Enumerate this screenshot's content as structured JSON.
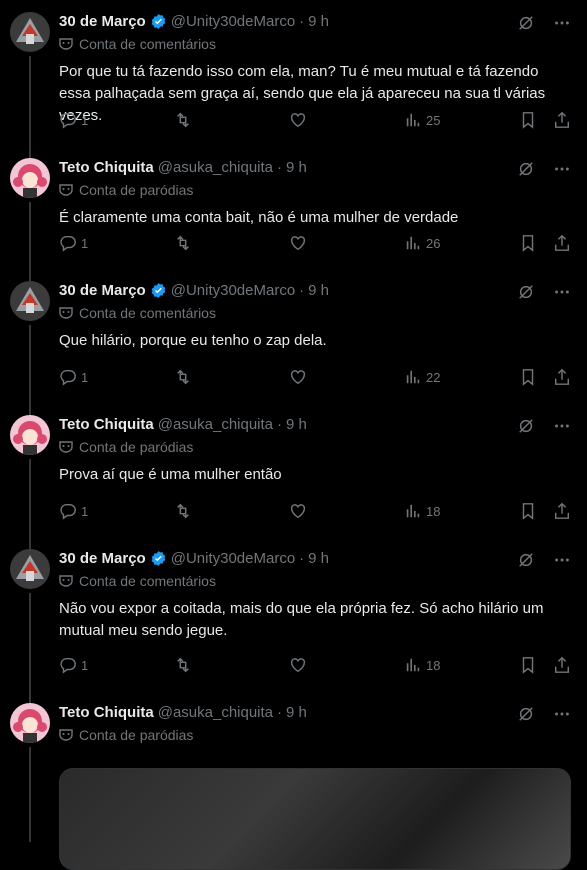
{
  "tweets": [
    {
      "author": "30 de Março",
      "handle": "@Unity30deMarco",
      "time": "9 h",
      "verified": true,
      "label": "Conta de comentários",
      "text": "Por que tu tá fazendo isso com ela, man? Tu é meu mutual e tá fazendo essa palhaçada sem graça aí, sendo que ela já apareceu na sua tl várias vezes.",
      "replies": "1",
      "retweets": "",
      "likes": "",
      "views": "25",
      "avatar": "robot"
    },
    {
      "author": "Teto Chiquita",
      "handle": "@asuka_chiquita",
      "time": "9 h",
      "verified": false,
      "label": "Conta de paródias",
      "text": "É claramente uma conta bait, não é uma mulher de verdade",
      "replies": "1",
      "retweets": "",
      "likes": "",
      "views": "26",
      "avatar": "anime"
    },
    {
      "author": "30 de Março",
      "handle": "@Unity30deMarco",
      "time": "9 h",
      "verified": true,
      "label": "Conta de comentários",
      "text": "Que hilário, porque eu tenho o zap dela.",
      "replies": "1",
      "retweets": "",
      "likes": "",
      "views": "22",
      "avatar": "robot"
    },
    {
      "author": "Teto Chiquita",
      "handle": "@asuka_chiquita",
      "time": "9 h",
      "verified": false,
      "label": "Conta de paródias",
      "text": "Prova aí que é uma mulher então",
      "replies": "1",
      "retweets": "",
      "likes": "",
      "views": "18",
      "avatar": "anime"
    },
    {
      "author": "30 de Março",
      "handle": "@Unity30deMarco",
      "time": "9 h",
      "verified": true,
      "label": "Conta de comentários",
      "text": "Não vou expor a coitada, mais do que ela própria fez. Só acho hilário um mutual meu sendo jegue.",
      "replies": "1",
      "retweets": "",
      "likes": "",
      "views": "18",
      "avatar": "robot"
    },
    {
      "author": "Teto Chiquita",
      "handle": "@asuka_chiquita",
      "time": "9 h",
      "verified": false,
      "label": "Conta de paródias",
      "text": "",
      "avatar": "anime"
    }
  ],
  "dot": "·",
  "colors": {
    "verified": "#1d9bf0",
    "muted": "#71767b",
    "background": "#000000"
  }
}
